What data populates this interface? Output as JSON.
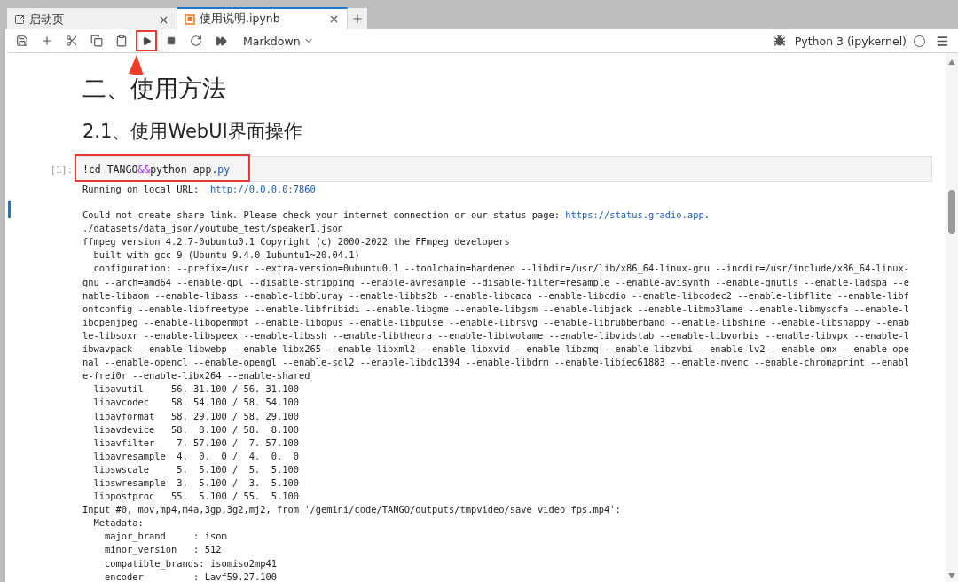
{
  "tabs": [
    {
      "label": "启动页",
      "kind": "launcher",
      "selected": false
    },
    {
      "label": "使用说明.ipynb",
      "kind": "notebook",
      "selected": true
    }
  ],
  "toolbar": {
    "buttons": [
      {
        "kind": "save",
        "highlighted": false
      },
      {
        "kind": "insert",
        "highlighted": false
      },
      {
        "kind": "cut",
        "highlighted": false
      },
      {
        "kind": "copy",
        "highlighted": false
      },
      {
        "kind": "paste",
        "highlighted": false
      },
      {
        "kind": "run",
        "highlighted": true
      },
      {
        "kind": "stop",
        "highlighted": false
      },
      {
        "kind": "restart",
        "highlighted": false
      },
      {
        "kind": "run-all",
        "highlighted": false
      }
    ],
    "cell_type": "Markdown",
    "kernel": "Python 3 (ipykernel)",
    "kernel_busy": false
  },
  "headings": [
    {
      "text": "二、使用方法",
      "kind": "title"
    },
    {
      "text": "2.1、使用WebUI界面操作",
      "kind": "section"
    }
  ],
  "cell": {
    "prompt": "[1]:",
    "highlighted": true,
    "code": [
      {
        "text": "!cd TANGO",
        "kind": "plain"
      },
      {
        "text": "&&",
        "kind": "operator"
      },
      {
        "text": "python app.",
        "kind": "plain"
      },
      {
        "text": "py",
        "kind": "property"
      }
    ],
    "output": [
      {
        "text": "Running on local URL:  ",
        "link": "http://0.0.0.0:7860"
      },
      {
        "text": "Could not create share link. Please check your internet connection or our status page: ",
        "link": "https://status.gradio.app",
        "tail": ".",
        "gap_before": true
      },
      {
        "text": "./datasets/data_json/youtube_test/speaker1.json"
      },
      {
        "text": "ffmpeg version 4.2.7-0ubuntu0.1 Copyright (c) 2000-2022 the FFmpeg developers"
      },
      {
        "text": "  built with gcc 9 (Ubuntu 9.4.0-1ubuntu1~20.04.1)"
      },
      {
        "text": "  configuration: --prefix=/usr --extra-version=0ubuntu0.1 --toolchain=hardened --libdir=/usr/lib/x86_64-linux-gnu --incdir=/usr/include/x86_64-linux-"
      },
      {
        "text": "gnu --arch=amd64 --enable-gpl --disable-stripping --enable-avresample --disable-filter=resample --enable-avisynth --enable-gnutls --enable-ladspa --e"
      },
      {
        "text": "nable-libaom --enable-libass --enable-libbluray --enable-libbs2b --enable-libcaca --enable-libcdio --enable-libcodec2 --enable-libflite --enable-libf"
      },
      {
        "text": "ontconfig --enable-libfreetype --enable-libfribidi --enable-libgme --enable-libgsm --enable-libjack --enable-libmp3lame --enable-libmysofa --enable-l"
      },
      {
        "text": "ibopenjpeg --enable-libopenmpt --enable-libopus --enable-libpulse --enable-librsvg --enable-librubberband --enable-libshine --enable-libsnappy --enab"
      },
      {
        "text": "le-libsoxr --enable-libspeex --enable-libssh --enable-libtheora --enable-libtwolame --enable-libvidstab --enable-libvorbis --enable-libvpx --enable-l"
      },
      {
        "text": "ibwavpack --enable-libwebp --enable-libx265 --enable-libxml2 --enable-libxvid --enable-libzmq --enable-libzvbi --enable-lv2 --enable-omx --enable-ope"
      },
      {
        "text": "nal --enable-opencl --enable-opengl --enable-sdl2 --enable-libdc1394 --enable-libdrm --enable-libiec61883 --enable-nvenc --enable-chromaprint --enabl"
      },
      {
        "text": "e-frei0r --enable-libx264 --enable-shared"
      },
      {
        "text": "  libavutil     56. 31.100 / 56. 31.100"
      },
      {
        "text": "  libavcodec    58. 54.100 / 58. 54.100"
      },
      {
        "text": "  libavformat   58. 29.100 / 58. 29.100"
      },
      {
        "text": "  libavdevice   58.  8.100 / 58.  8.100"
      },
      {
        "text": "  libavfilter    7. 57.100 /  7. 57.100"
      },
      {
        "text": "  libavresample  4.  0.  0 /  4.  0.  0"
      },
      {
        "text": "  libswscale     5.  5.100 /  5.  5.100"
      },
      {
        "text": "  libswresample  3.  5.100 /  3.  5.100"
      },
      {
        "text": "  libpostproc   55.  5.100 / 55.  5.100"
      },
      {
        "text": "Input #0, mov,mp4,m4a,3gp,3g2,mj2, from '/gemini/code/TANGO/outputs/tmpvideo/save_video_fps.mp4':"
      },
      {
        "text": "  Metadata:"
      },
      {
        "text": "    major_brand     : isom"
      },
      {
        "text": "    minor_version   : 512"
      },
      {
        "text": "    compatible_brands: isomiso2mp41"
      },
      {
        "text": "    encoder         : Lavf59.27.100"
      }
    ]
  }
}
